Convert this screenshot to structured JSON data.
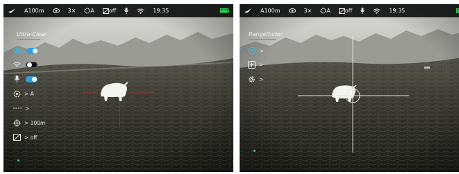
{
  "status_bar": {
    "zoom_profile": "A100m",
    "eye_icon": "eye-icon",
    "digital_zoom": "3×",
    "calibration_mode": "A",
    "pip_state": "off",
    "mic_icon": "mic-icon",
    "wifi_icon": "wifi-icon",
    "time": "19:35",
    "battery_color": "#33cc55"
  },
  "left_screen": {
    "menu_title": "Ultra-Clear",
    "items": [
      {
        "icon": "eye-icon",
        "type": "toggle",
        "state": "on",
        "selected": true
      },
      {
        "icon": "wifi-icon",
        "type": "toggle",
        "state": "off",
        "selected": false
      },
      {
        "icon": "mic-icon",
        "type": "toggle",
        "state": "on",
        "selected": false
      },
      {
        "icon": "calibration-icon",
        "type": "value",
        "value": "> A"
      },
      {
        "icon": "dashed-line-icon",
        "type": "value",
        "value": ">"
      },
      {
        "icon": "crosshair-icon",
        "type": "value",
        "value": "> 100m"
      },
      {
        "icon": "pip-icon",
        "type": "value",
        "value": "> off"
      }
    ]
  },
  "right_screen": {
    "menu_title": "Rangefinder",
    "items": [
      {
        "icon": "rangefinder-icon",
        "value": ">",
        "selected": true
      },
      {
        "icon": "plus-box-icon",
        "value": ">"
      },
      {
        "icon": "gear-icon",
        "value": ">"
      }
    ]
  },
  "colors": {
    "accent_green": "#24b45a",
    "toggle_on": "#2aa0e6",
    "selection_arrow": "#2ec1e0",
    "reticle_left": "#b8322a",
    "reticle_right": "#e8e6de"
  }
}
